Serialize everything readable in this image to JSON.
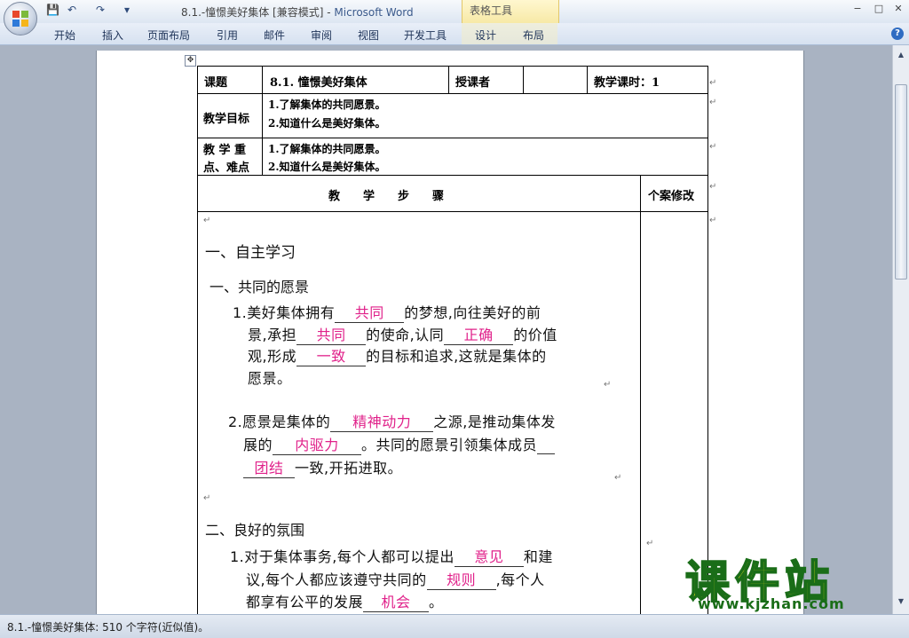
{
  "window": {
    "title_prefix": "8.1.-憧憬美好集体 [兼容模式] - ",
    "app_name": "Microsoft Word",
    "table_tools": "表格工具",
    "minimize": "−",
    "restore": "□",
    "close": "✕"
  },
  "quick_access": {
    "save": "💾",
    "undo": "↶",
    "redo": "↷",
    "customize": "▾"
  },
  "ribbon": {
    "tabs": [
      "开始",
      "插入",
      "页面布局",
      "引用",
      "邮件",
      "审阅",
      "视图",
      "开发工具",
      "设计",
      "布局"
    ],
    "help": "?"
  },
  "table": {
    "topic_label": "课题",
    "topic_value": "8.1. 憧憬美好集体",
    "teacher_label": "授课者",
    "hours_label": "教学课时：1",
    "goal_label": "教学目标",
    "goals": [
      "1.了解集体的共同愿景。",
      "2.知道什么是美好集体。"
    ],
    "key_label_1": "教 学 重",
    "key_label_2": "点、难点",
    "keys": [
      "1.了解集体的共同愿景。",
      "2.知道什么是美好集体。"
    ],
    "steps_header": "教　　学　　步　　骤",
    "revise_header": "个案修改"
  },
  "content": {
    "section1": "一、自主学习",
    "sub1": "一、共同的愿景",
    "p1_l1_a": "1.美好集体拥有",
    "p1_b1": "共同",
    "p1_l1_b": "的梦想,向往美好的前",
    "p1_l2_a": "景,承担",
    "p1_b2": "共同",
    "p1_l2_b": "的使命,认同",
    "p1_b3": "正确",
    "p1_l2_c": "的价值",
    "p1_l3_a": "观,形成",
    "p1_b4": "一致",
    "p1_l3_b": "的目标和追求,这就是集体的",
    "p1_l4": "愿景。",
    "p2_l1_a": "2.愿景是集体的",
    "p2_b1": "精神动力",
    "p2_l1_b": "之源,是推动集体发",
    "p2_l2_a": "展的",
    "p2_b2": "内驱力",
    "p2_l2_b": "。共同的愿景引领集体成员",
    "p2_b3": "团结",
    "p2_l3_b": "一致,开拓进取。",
    "sub2": "二、良好的氛围",
    "p3_l1_a": "1.对于集体事务,每个人都可以提出",
    "p3_b1": "意见",
    "p3_l1_b": "和建",
    "p3_l2_a": "议,每个人都应该遵守共同的",
    "p3_b2": "规则",
    "p3_l2_b": ",每个人",
    "p3_l3_a": "都享有公平的发展",
    "p3_b3": "机会",
    "p3_l3_b": "。"
  },
  "watermark": {
    "text": "课件站",
    "url": "www.kjzhan.com"
  },
  "status": "8.1.-憧憬美好集体: 510 个字符(近似值)。",
  "para_mark": "↵",
  "move_handle": "✥"
}
